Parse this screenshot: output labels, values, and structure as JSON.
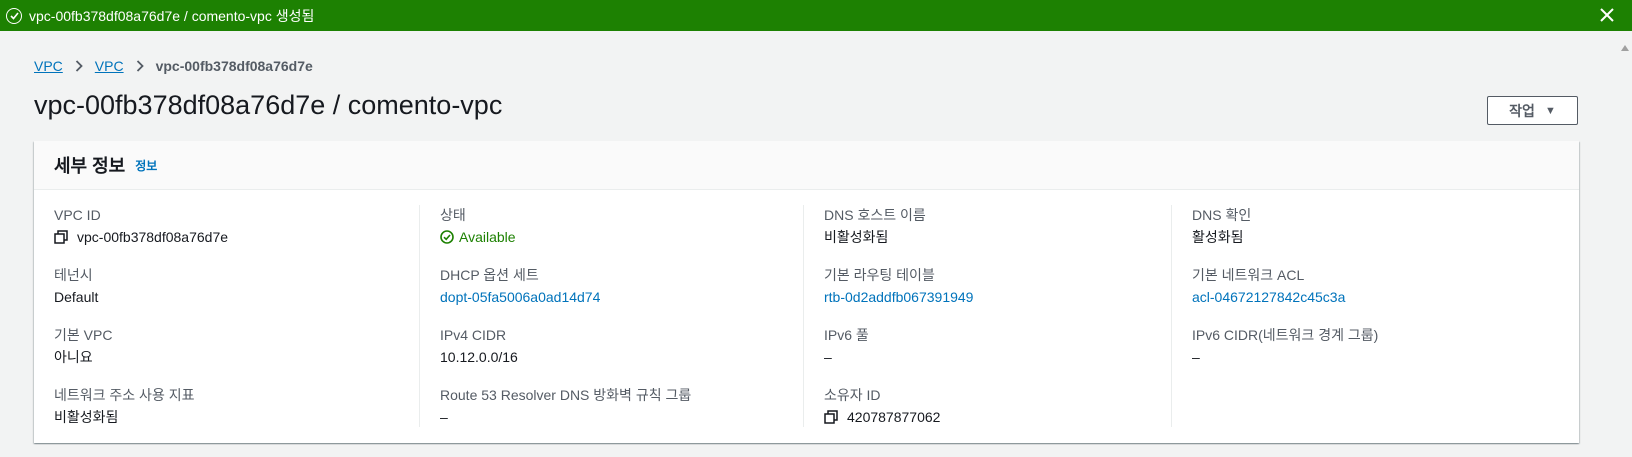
{
  "flash": {
    "message": "vpc-00fb378df08a76d7e / comento-vpc 생성됨",
    "color": "#1d8102"
  },
  "breadcrumb": {
    "items": [
      "VPC",
      "VPC"
    ],
    "current": "vpc-00fb378df08a76d7e"
  },
  "page": {
    "title": "vpc-00fb378df08a76d7e / comento-vpc",
    "action_label": "작업"
  },
  "details": {
    "title": "세부 정보",
    "info_link": "정보",
    "col1": [
      {
        "label": "VPC ID",
        "value": "vpc-00fb378df08a76d7e"
      },
      {
        "label": "테넌시",
        "value": "Default"
      },
      {
        "label": "기본 VPC",
        "value": "아니요"
      },
      {
        "label": "네트워크 주소 사용 지표",
        "value": "비활성화됨"
      }
    ],
    "col2": [
      {
        "label": "상태",
        "value": "Available"
      },
      {
        "label": "DHCP 옵션 세트",
        "value": "dopt-05fa5006a0ad14d74"
      },
      {
        "label": "IPv4 CIDR",
        "value": "10.12.0.0/16"
      },
      {
        "label": "Route 53 Resolver DNS 방화벽 규칙 그룹",
        "value": "–"
      }
    ],
    "col3": [
      {
        "label": "DNS 호스트 이름",
        "value": "비활성화됨"
      },
      {
        "label": "기본 라우팅 테이블",
        "value": "rtb-0d2addfb067391949"
      },
      {
        "label": "IPv6 풀",
        "value": "–"
      },
      {
        "label": "소유자 ID",
        "value": "420787877062"
      }
    ],
    "col4": [
      {
        "label": "DNS 확인",
        "value": "활성화됨"
      },
      {
        "label": "기본 네트워크 ACL",
        "value": "acl-04672127842c45c3a"
      },
      {
        "label": "IPv6 CIDR(네트워크 경계 그룹)",
        "value": "–"
      }
    ]
  },
  "colors": {
    "link": "#0073bb",
    "success": "#1d8102"
  }
}
